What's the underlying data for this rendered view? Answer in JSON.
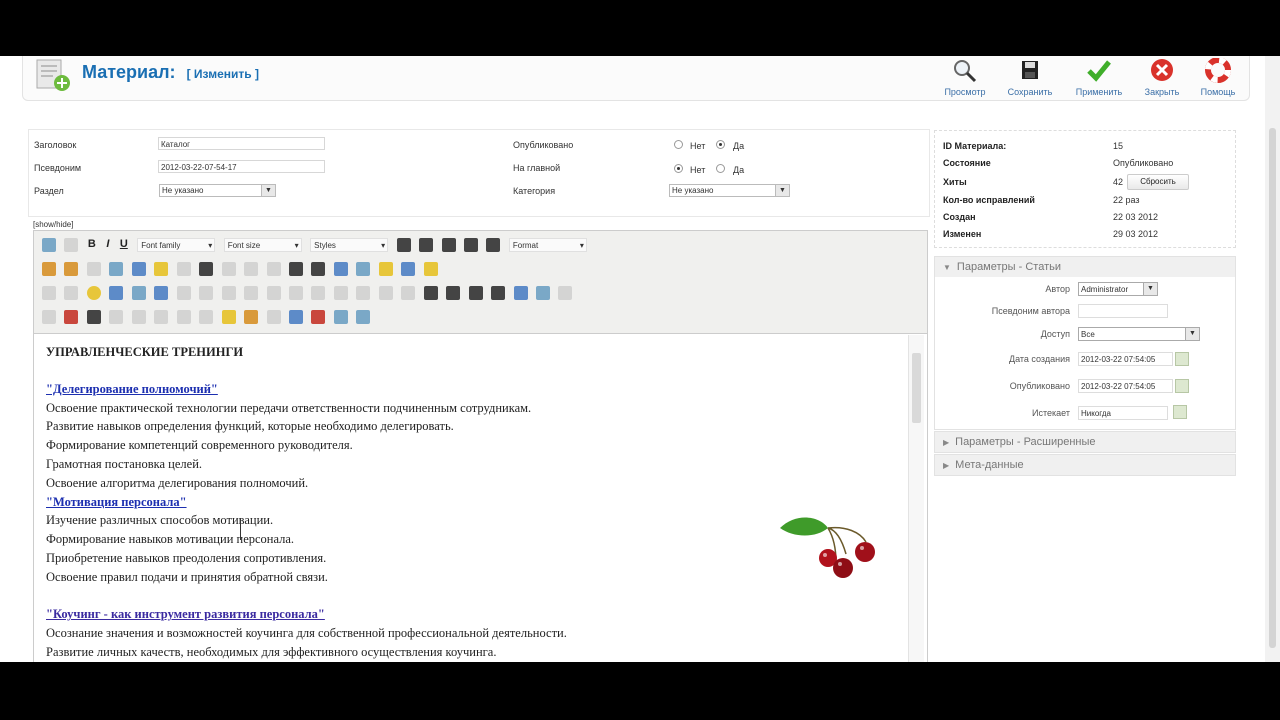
{
  "header": {
    "title": "Материал:",
    "subtitle": "[ Изменить ]",
    "buttons": [
      {
        "label": "Просмотр",
        "icon": "magnifier-icon"
      },
      {
        "label": "Сохранить",
        "icon": "floppy-icon"
      },
      {
        "label": "Применить",
        "icon": "checkmark-icon"
      },
      {
        "label": "Закрыть",
        "icon": "close-icon"
      },
      {
        "label": "Помощь",
        "icon": "lifebuoy-icon"
      }
    ]
  },
  "form": {
    "title_label": "Заголовок",
    "title_value": "Каталог",
    "alias_label": "Псевдоним",
    "alias_value": "2012-03-22-07-54-17",
    "section_label": "Раздел",
    "section_value": "Не указано",
    "published_label": "Опубликовано",
    "frontpage_label": "На главной",
    "category_label": "Категория",
    "category_value": "Не указано",
    "no_label": "Нет",
    "yes_label": "Да"
  },
  "editor": {
    "show_hide": "[show/hide]",
    "font_family": "Font family",
    "font_size": "Font size",
    "styles": "Styles",
    "format": "Format",
    "content": {
      "heading": "УПРАВЛЕНЧЕСКИЕ ТРЕНИНГИ",
      "link1": "\"Делегирование полномочий\"",
      "lines1": [
        "Освоение практической технологии передачи ответственности подчиненным сотрудникам.",
        "Развитие навыков определения функций, которые необходимо делегировать.",
        "Формирование компетенций современного руководителя.",
        "Грамотная постановка целей.",
        "Освоение алгоритма делегирования полномочий."
      ],
      "link2": "\"Мотивация персонала\"",
      "lines2": [
        "Изучение различных способов мотивации.",
        "Формирование навыков мотивации персонала.",
        "Приобретение навыков преодоления сопротивления.",
        "Освоение правил подачи и принятия обратной связи."
      ],
      "link3": "\"Коучинг - как инструмент развития персонала\"",
      "lines3": [
        "Осознание значения и возможностей коучинга для собственной профессиональной деятельности.",
        "Развитие личных качеств, необходимых для эффективного осуществления коучинга."
      ]
    }
  },
  "info": {
    "id_label": "ID Материала:",
    "id_value": "15",
    "state_label": "Состояние",
    "state_value": "Опубликовано",
    "hits_label": "Хиты",
    "hits_value": "42",
    "reset_label": "Сбросить",
    "revisions_label": "Кол-во исправлений",
    "revisions_value": "22 раз",
    "created_label": "Создан",
    "created_value": "22 03 2012",
    "modified_label": "Изменен",
    "modified_value": "29 03 2012"
  },
  "params": {
    "title": "Параметры - Статьи",
    "author_label": "Автор",
    "author_value": "Administrator",
    "alias_label": "Псевдоним автора",
    "access_label": "Доступ",
    "access_value": "Все",
    "created_label": "Дата создания",
    "created_value": "2012-03-22 07:54:05",
    "published_label": "Опубликовано",
    "published_value": "2012-03-22 07:54:05",
    "expires_label": "Истекает",
    "expires_value": "Никогда"
  },
  "panels": {
    "advanced": "Параметры - Расширенные",
    "meta": "Мета-данные"
  },
  "colors": {
    "title": "#1a6fb3",
    "link": "#1c2fb0"
  }
}
